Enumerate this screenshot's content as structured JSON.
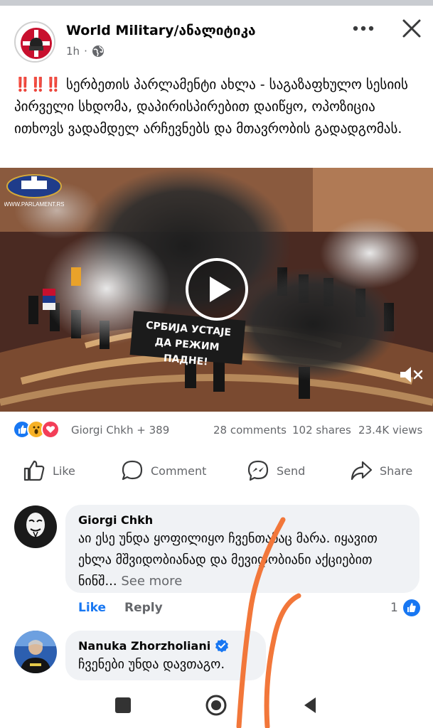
{
  "post": {
    "page_name": "World Military/ანალიტიკა",
    "time": "1h",
    "globe_icon": "globe-icon",
    "caption_emoji": "‼️‼️‼️",
    "caption_text": "სერბეთის პარლამენტი ახლა - საგაზაფხულო სესიის პირველი სხდომა, დაპირისპირებით დაიწყო, ოპოზიცია ითხოვს ვადამდელ არჩევნებს და მთავრობის გადადგომას."
  },
  "video": {
    "channel_label": "WWW.PARLAMENT.RS",
    "banner_line1": "СРБИЈА УСТАЈЕ",
    "banner_line2": "ДА РЕЖИМ ПАДНЕ!"
  },
  "stats": {
    "reactors": "Giorgi Chkh + 389",
    "comments": "28 comments",
    "shares": "102 shares",
    "views": "23.4K views"
  },
  "actions": {
    "like": "Like",
    "comment": "Comment",
    "send": "Send",
    "share": "Share"
  },
  "comments": [
    {
      "author": "Giorgi Chkh",
      "text": "აი ესე უნდა ყოფილიყო ჩვენთანაც მარა. იყავით ეხლა მშვიდობიანად და მევიდობიანი აქციებით ნინშ...",
      "see_more": "See more",
      "like_label": "Like",
      "reply_label": "Reply",
      "reaction_count": "1"
    },
    {
      "author": "Nanuka Zhorzholiani",
      "verified": true,
      "text": "ჩვენები უნდა დავთაგო."
    }
  ],
  "colors": {
    "facebook_blue": "#1877f2",
    "scribble": "#f2773a",
    "muted": "#65676b"
  }
}
